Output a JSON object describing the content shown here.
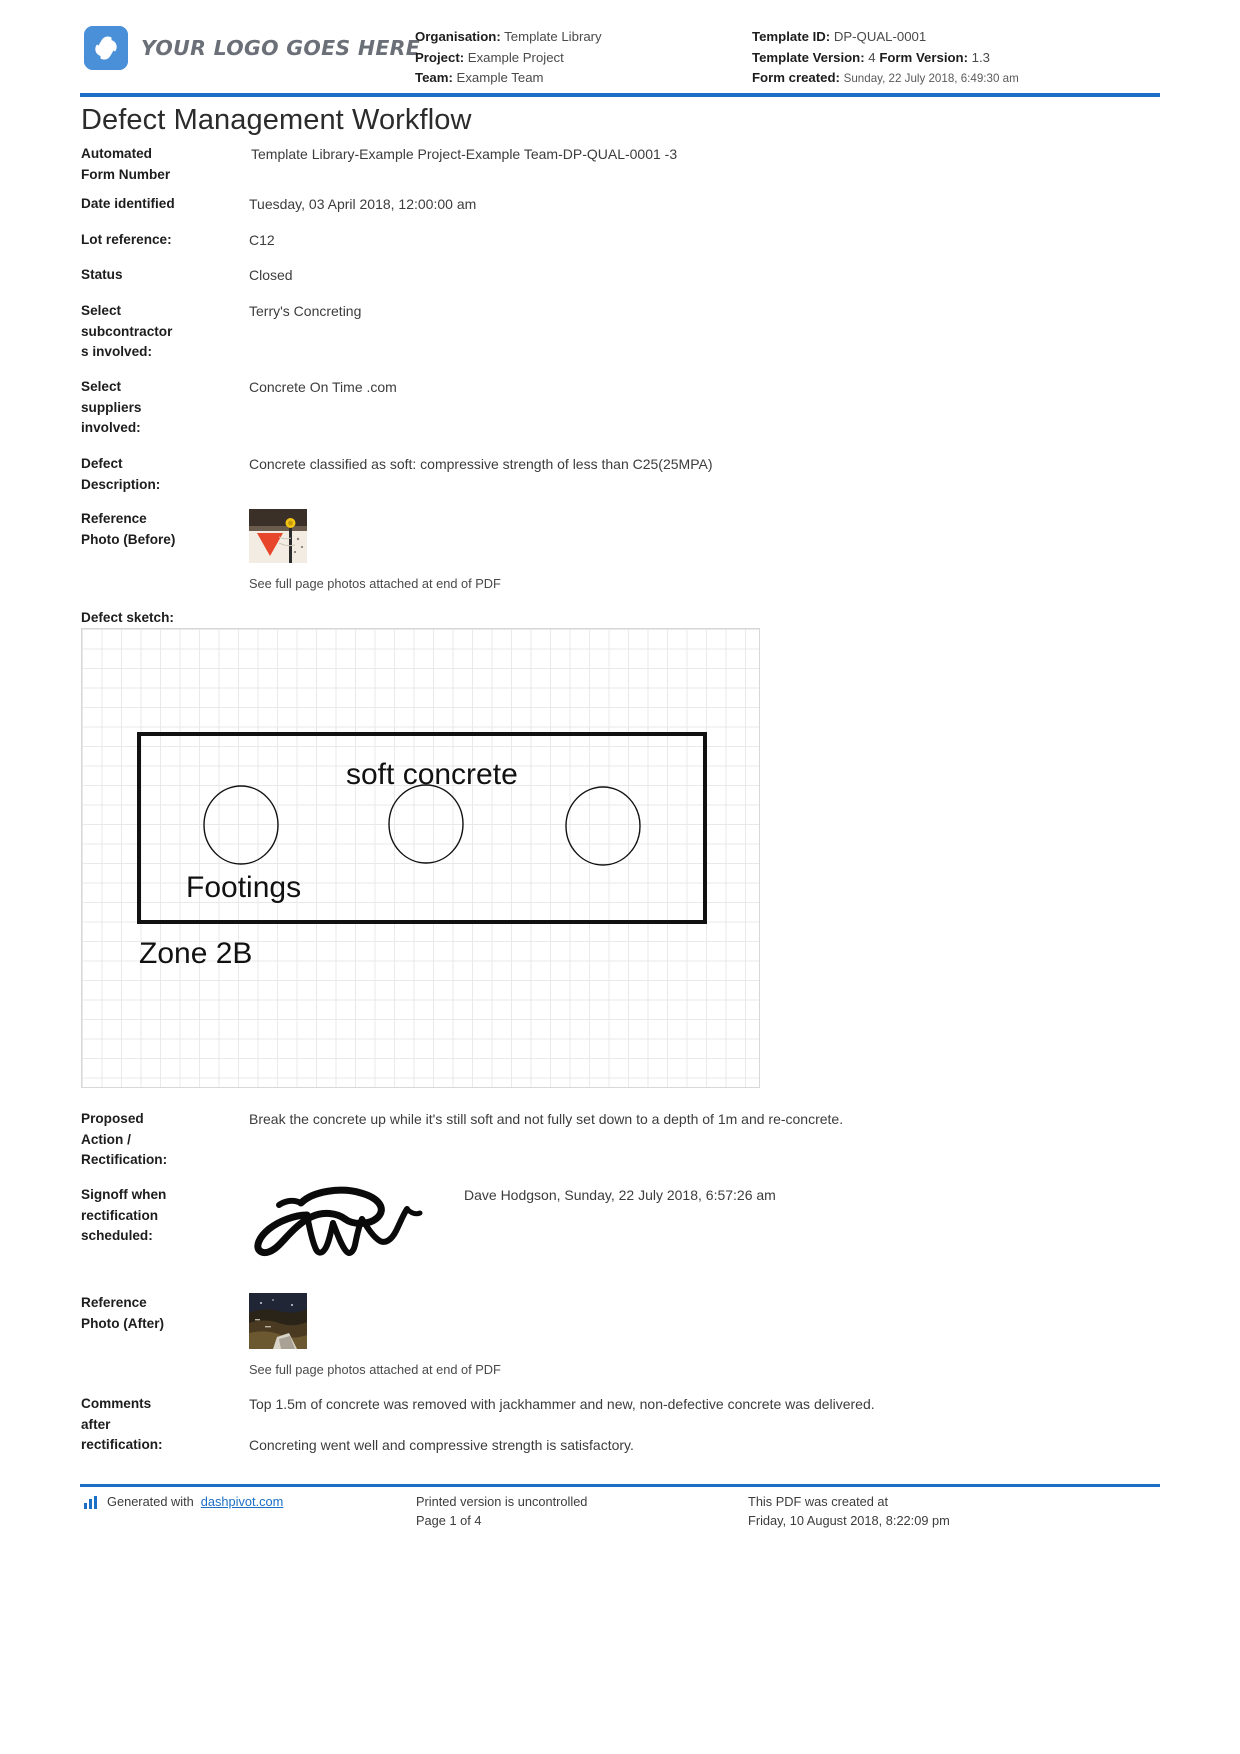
{
  "header": {
    "logo_text": "YOUR LOGO GOES HERE",
    "logo_color": "#4a90d9",
    "rule_color": "#1b6fc4",
    "meta_mid": [
      {
        "label": "Organisation:",
        "value": "Template Library"
      },
      {
        "label": "Project:",
        "value": "Example Project"
      },
      {
        "label": "Team:",
        "value": "Example Team"
      }
    ],
    "meta_right": {
      "template_id_label": "Template ID:",
      "template_id_value": "DP-QUAL-0001",
      "template_version_label": "Template Version:",
      "template_version_value": "4",
      "form_version_label": "Form Version:",
      "form_version_value": "1.3",
      "form_created_label": "Form created:",
      "form_created_value": "Sunday, 22 July 2018, 6:49:30 am"
    }
  },
  "document": {
    "title": "Defect Management Workflow"
  },
  "fields": {
    "automated_form_number": {
      "label_line1": "Automated",
      "label_line2": "Form Number",
      "value": "Template Library-Example Project-Example Team-DP-QUAL-0001   -3"
    },
    "date_identified": {
      "label": "Date identified",
      "value": "Tuesday, 03 April 2018, 12:00:00 am"
    },
    "lot_reference": {
      "label": "Lot reference:",
      "value": "C12"
    },
    "status": {
      "label": "Status",
      "value": "Closed"
    },
    "subcontractors": {
      "label_line1": "Select",
      "label_line2": "subcontractor",
      "label_line3": "s involved:",
      "value": "Terry's Concreting"
    },
    "suppliers": {
      "label_line1": "Select",
      "label_line2": "suppliers",
      "label_line3": "involved:",
      "value": "Concrete On Time .com"
    },
    "defect_description": {
      "label_line1": "Defect",
      "label_line2": "Description:",
      "value": "Concrete classified as soft: compressive strength of less than C25(25MPA)"
    },
    "reference_photo_before": {
      "label_line1": "Reference",
      "label_line2": "Photo (Before)",
      "caption": "See full page photos attached at end of PDF"
    },
    "defect_sketch": {
      "label": "Defect sketch:"
    },
    "proposed_action": {
      "label_line1": "Proposed",
      "label_line2": "Action /",
      "label_line3": "Rectification:",
      "value": "Break the concrete up while it's still soft and not fully set down to a depth of 1m and re-concrete."
    },
    "signoff": {
      "label_line1": "Signoff when",
      "label_line2": "rectification",
      "label_line3": "scheduled:",
      "value": "Dave Hodgson, Sunday, 22 July 2018, 6:57:26 am"
    },
    "reference_photo_after": {
      "label_line1": "Reference",
      "label_line2": "Photo (After)",
      "caption": "See full page photos attached at end of PDF"
    },
    "comments_after_rectification": {
      "label_line1": "Comments",
      "label_line2": "after",
      "label_line3": "rectification:",
      "value_line1": "Top 1.5m of concrete was removed with jackhammer and new, non-defective concrete was delivered.",
      "value_line2": "Concreting went well and compressive strength is satisfactory."
    }
  },
  "sketch": {
    "labels": {
      "soft_concrete": "soft concrete",
      "footings": "Footings",
      "zone": "Zone 2B"
    }
  },
  "footer": {
    "generated_prefix": "Generated with ",
    "generated_link": "dashpivot.com",
    "printed_line1": "Printed version is uncontrolled",
    "printed_line2": "Page 1 of 4",
    "created_line1": "This PDF was created at",
    "created_line2": "Friday, 10 August 2018, 8:22:09 pm"
  }
}
